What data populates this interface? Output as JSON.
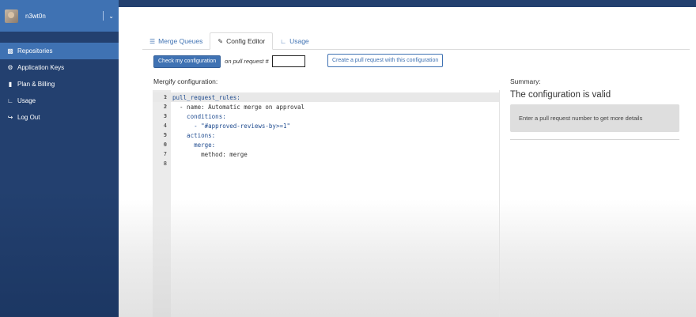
{
  "user": {
    "name": "n3wt0n"
  },
  "sidebar": {
    "items": [
      {
        "label": "Repositories",
        "icon": "sitemap-icon",
        "active": true
      },
      {
        "label": "Application Keys",
        "icon": "gear-icon",
        "active": false
      },
      {
        "label": "Plan & Billing",
        "icon": "file-icon",
        "active": false
      },
      {
        "label": "Usage",
        "icon": "chart-icon",
        "active": false
      },
      {
        "label": "Log Out",
        "icon": "logout-icon",
        "active": false
      }
    ]
  },
  "tabs": [
    {
      "label": "Merge Queues",
      "icon": "list-icon",
      "active": false
    },
    {
      "label": "Config Editor",
      "icon": "edit-icon",
      "active": true
    },
    {
      "label": "Usage",
      "icon": "chart-icon",
      "active": false
    }
  ],
  "actions": {
    "check_label": "Check my configuration",
    "on_pr_text": "on pull request #",
    "pr_value": "",
    "create_pr_label": "Create a pull request with this configuration"
  },
  "editor": {
    "label": "Mergify configuration:",
    "lines": [
      {
        "n": "1",
        "text": "pull_request_rules:"
      },
      {
        "n": "2",
        "text": "  - name: Automatic merge on approval"
      },
      {
        "n": "3",
        "text": "    conditions:"
      },
      {
        "n": "4",
        "text": "      - \"#approved-reviews-by>=1\""
      },
      {
        "n": "5",
        "text": "    actions:"
      },
      {
        "n": "6",
        "text": "      merge:"
      },
      {
        "n": "7",
        "text": "        method: merge"
      },
      {
        "n": "8",
        "text": ""
      }
    ]
  },
  "summary": {
    "label": "Summary:",
    "title": "The configuration is valid",
    "hint": "Enter a pull request number to get more details"
  }
}
